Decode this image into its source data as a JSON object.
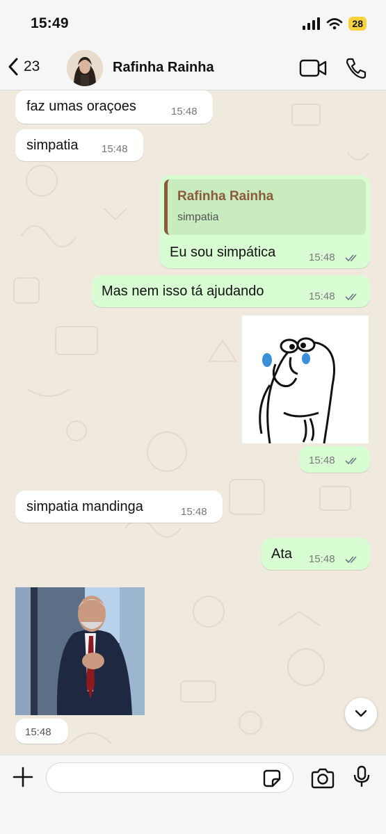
{
  "status_bar": {
    "time": "15:49",
    "battery": "28"
  },
  "header": {
    "back_count": "23",
    "contact_name": "Rafinha Rainha"
  },
  "messages": [
    {
      "text": "faz umas oraçoes",
      "time": "15:48"
    },
    {
      "text": "simpatia",
      "time": "15:48"
    },
    {
      "quote_name": "Rafinha Rainha",
      "quote_text": "simpatia",
      "text": "Eu sou simpática",
      "time": "15:48"
    },
    {
      "text": "Mas nem isso tá ajudando",
      "time": "15:48"
    },
    {
      "time": "15:48"
    },
    {
      "text": "simpatia mandinga",
      "time": "15:48"
    },
    {
      "text": "Ata",
      "time": "15:48"
    },
    {
      "time": "15:48"
    }
  ],
  "composer": {
    "placeholder": ""
  },
  "colors": {
    "incoming": "#ffffff",
    "outgoing": "#d9fdd3",
    "read_ticks": "#667781",
    "quote_accent": "#8a5a3b"
  }
}
